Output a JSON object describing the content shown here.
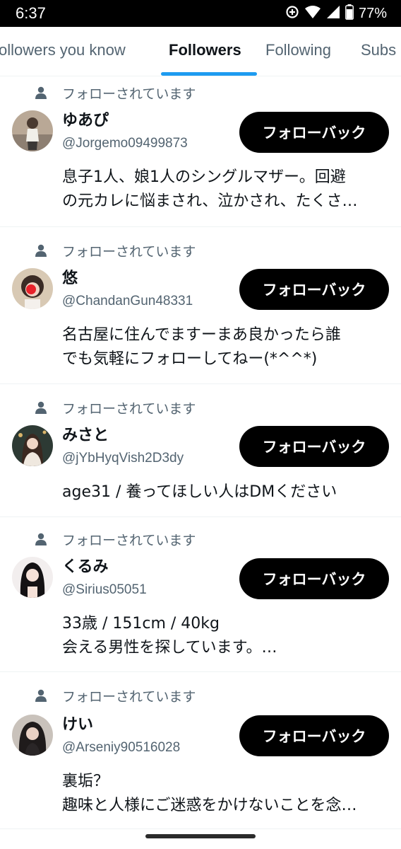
{
  "status": {
    "time": "6:37",
    "battery": "77%",
    "icons": [
      "data-saver-icon",
      "wifi-icon",
      "signal-icon",
      "battery-icon"
    ]
  },
  "tabs": [
    {
      "label": "ollowers you know",
      "active": false
    },
    {
      "label": "Followers",
      "active": true
    },
    {
      "label": "Following",
      "active": false
    },
    {
      "label": "Subs",
      "active": false
    }
  ],
  "accent_color": "#1d9bf0",
  "items": [
    {
      "context": "フォローされています",
      "name": "ゆあぴ",
      "handle": "@Jorgemo09499873",
      "button": "フォローバック",
      "bio": [
        "息子1人、娘1人のシングルマザー。回避",
        "の元カレに悩まされ、泣かされ、たくさ…"
      ]
    },
    {
      "context": "フォローされています",
      "name": "悠",
      "handle": "@ChandanGun48331",
      "button": "フォローバック",
      "bio": [
        "名古屋に住んでますーまあ良かったら誰",
        "でも気軽にフォローしてねー(*^^*)"
      ]
    },
    {
      "context": "フォローされています",
      "name": "みさと",
      "handle": "@jYbHyqVish2D3dy",
      "button": "フォローバック",
      "bio": [
        "age31 / 養ってほしい人はDMください"
      ]
    },
    {
      "context": "フォローされています",
      "name": "くるみ",
      "handle": "@Sirius05051",
      "button": "フォローバック",
      "bio": [
        "33歳 / 151cm / 40kg",
        "会える男性を探しています。…"
      ]
    },
    {
      "context": "フォローされています",
      "name": "けい",
      "handle": "@Arseniy90516028",
      "button": "フォローバック",
      "bio": [
        "裏垢？",
        "趣味と人様にご迷惑をかけないことを念…"
      ]
    }
  ]
}
